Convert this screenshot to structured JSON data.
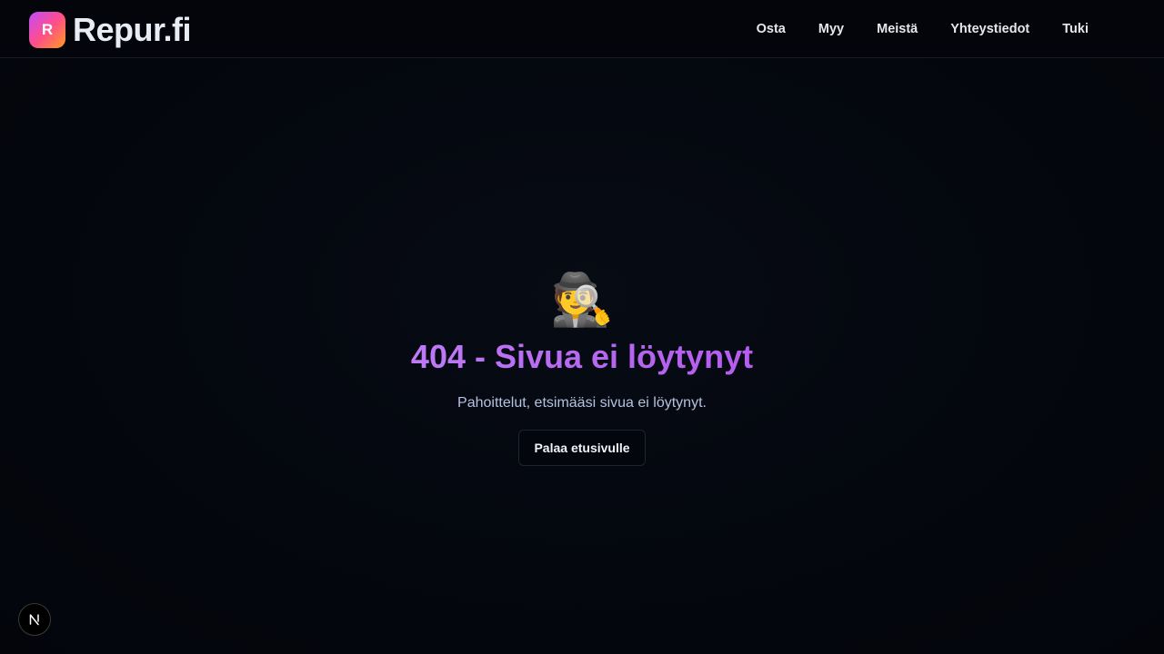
{
  "header": {
    "logo_letter": "R",
    "logo_text": "Repur.fi",
    "nav": [
      {
        "label": "Osta"
      },
      {
        "label": "Myy"
      },
      {
        "label": "Meistä"
      },
      {
        "label": "Yhteystiedot"
      },
      {
        "label": "Tuki"
      }
    ]
  },
  "main": {
    "emoji": "🕵️",
    "title": "404 - Sivua ei löytynyt",
    "subtitle": "Pahoittelut, etsimääsi sivua ei löytynyt.",
    "button_label": "Palaa etusivulle"
  },
  "dev_badge": {
    "icon": "nextjs-n-icon"
  },
  "colors": {
    "background": "#04070e",
    "title_gradient_start": "#bf7af6",
    "title_gradient_end": "#b65cf0",
    "logo_gradient": [
      "#c04dff",
      "#ff4d8d",
      "#ff9a1f"
    ],
    "subtitle": "#b4c2e0"
  }
}
